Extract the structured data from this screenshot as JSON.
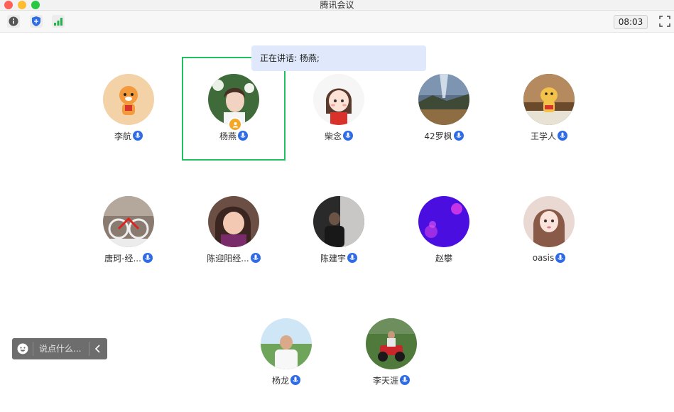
{
  "window": {
    "title": "腾讯会议"
  },
  "toolbar": {
    "clock": "08:03",
    "icons": [
      "info-icon",
      "shield-icon",
      "signal-icon",
      "fullscreen-icon"
    ]
  },
  "speaking_banner": "正在讲话: 杨燕;",
  "participants": [
    {
      "name": "李航",
      "avatar": "tiger-illustration"
    },
    {
      "name": "杨燕",
      "avatar": "photo-woman-flowers",
      "host": true,
      "active_speaker": true
    },
    {
      "name": "柴念",
      "avatar": "cartoon-girl"
    },
    {
      "name": "42罗枫",
      "avatar": "lake-mountain-photo"
    },
    {
      "name": "王学人",
      "avatar": "toy-figure"
    },
    {
      "name": "唐珂-经...",
      "avatar": "bicycle-photo"
    },
    {
      "name": "陈迎阳经...",
      "avatar": "photo-woman-smiling"
    },
    {
      "name": "陈建宇",
      "avatar": "photo-man-dark-room"
    },
    {
      "name": "赵攀",
      "avatar": "purple-jellyfish"
    },
    {
      "name": "oasis",
      "avatar": "photo-woman-portrait"
    },
    {
      "name": "杨龙",
      "avatar": "photo-man-outdoor"
    },
    {
      "name": "李天涯",
      "avatar": "photo-atv-grass"
    }
  ],
  "chat": {
    "placeholder": "说点什么..."
  },
  "colors": {
    "active_border": "#20c060",
    "mic_blue": "#2f6be6",
    "banner_bg": "#dfe9fb",
    "host_badge": "#f5a623"
  }
}
